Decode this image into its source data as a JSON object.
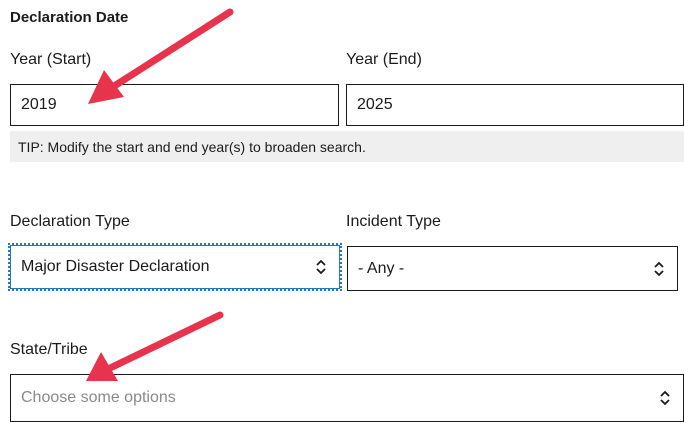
{
  "declaration_date": {
    "section_label": "Declaration Date",
    "year_start": {
      "label": "Year (Start)",
      "value": "2019"
    },
    "year_end": {
      "label": "Year (End)",
      "value": "2025"
    },
    "tip": "TIP: Modify the start and end year(s) to broaden search."
  },
  "declaration_type": {
    "label": "Declaration Type",
    "selected": "Major Disaster Declaration"
  },
  "incident_type": {
    "label": "Incident Type",
    "selected": "- Any -"
  },
  "state_tribe": {
    "label": "State/Tribe",
    "placeholder": "Choose some options"
  },
  "colors": {
    "annotation_arrow": "#e8334d",
    "focus_outline": "#2378c3"
  }
}
